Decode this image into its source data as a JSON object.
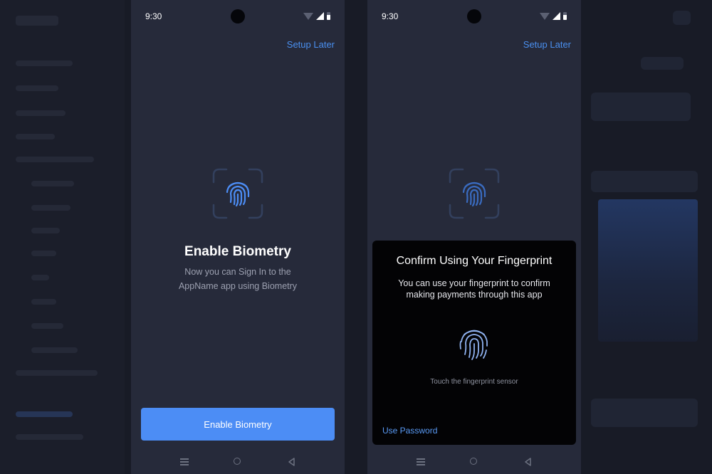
{
  "status_bar": {
    "time": "9:30"
  },
  "screen1": {
    "setup_later": "Setup Later",
    "title": "Enable Biometry",
    "subtitle": "Now you can Sign In to the AppName app using Biometry",
    "button_label": "Enable Biometry",
    "icon": "fingerprint-icon"
  },
  "screen2": {
    "setup_later": "Setup Later",
    "dialog": {
      "title": "Confirm Using Your Fingerprint",
      "body": "You can use your fingerprint to confirm making payments through this app",
      "hint": "Touch the fingerprint sensor",
      "use_password": "Use Password",
      "icon": "fingerprint-icon"
    }
  },
  "navigation": {
    "icons": [
      "menu-icon",
      "home-icon",
      "back-icon"
    ]
  },
  "colors": {
    "accent": "#4c8df5",
    "screen_bg": "#262a3a",
    "dialog_bg": "#030305",
    "link": "#4a90f0"
  }
}
